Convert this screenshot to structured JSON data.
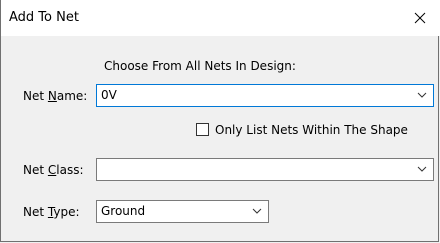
{
  "window": {
    "title": "Add To Net"
  },
  "header": {
    "instruction": "Choose From All Nets In Design:"
  },
  "net_name": {
    "label_pre": "Net ",
    "label_accel": "N",
    "label_post": "ame:",
    "value": "0V"
  },
  "only_list": {
    "label": "Only List Nets Within The Shape",
    "checked": false
  },
  "net_class": {
    "label_pre": "Net ",
    "label_accel": "C",
    "label_post": "lass:",
    "value": ""
  },
  "net_type": {
    "label_pre": "Net ",
    "label_accel": "T",
    "label_post": "ype:",
    "value": "Ground"
  },
  "icons": {
    "close": "close-icon",
    "dropdown": "chevron-down-icon"
  }
}
